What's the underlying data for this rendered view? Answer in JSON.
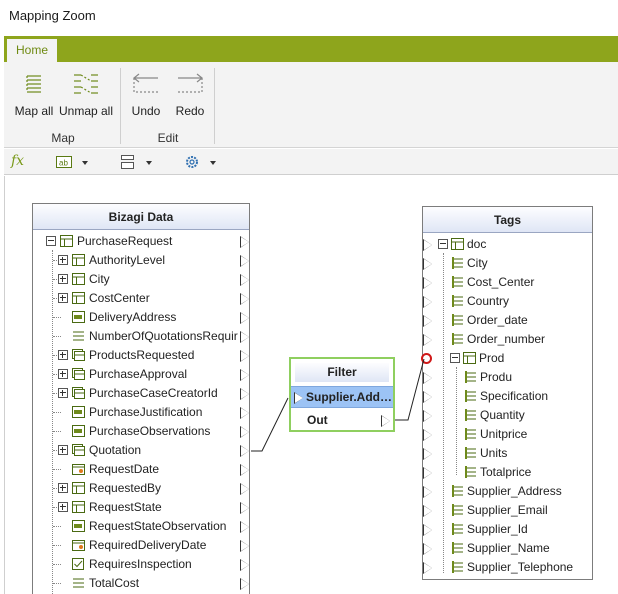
{
  "window": {
    "title": "Mapping Zoom"
  },
  "ribbon": {
    "tab_home": "Home",
    "map_all": "Map all",
    "unmap_all": "Unmap all",
    "undo": "Undo",
    "redo": "Redo",
    "group_map": "Map",
    "group_edit": "Edit"
  },
  "toolbar": {
    "fx": "fx",
    "text_icon_label": "ab"
  },
  "left_panel": {
    "title": "Bizagi Data",
    "items": [
      {
        "label": "PurchaseRequest",
        "icon": "entity-icon"
      },
      {
        "label": "AuthorityLevel",
        "icon": "table-icon"
      },
      {
        "label": "City",
        "icon": "table-icon"
      },
      {
        "label": "CostCenter",
        "icon": "table-icon"
      },
      {
        "label": "DeliveryAddress",
        "icon": "text-field-icon"
      },
      {
        "label": "NumberOfQuotationsRequir",
        "icon": "number-field-icon"
      },
      {
        "label": "ProductsRequested",
        "icon": "collection-icon"
      },
      {
        "label": "PurchaseApproval",
        "icon": "collection-icon"
      },
      {
        "label": "PurchaseCaseCreatorId",
        "icon": "collection-icon"
      },
      {
        "label": "PurchaseJustification",
        "icon": "text-field-icon"
      },
      {
        "label": "PurchaseObservations",
        "icon": "text-field-icon"
      },
      {
        "label": "Quotation",
        "icon": "collection-icon"
      },
      {
        "label": "RequestDate",
        "icon": "date-field-icon"
      },
      {
        "label": "RequestedBy",
        "icon": "entity-icon"
      },
      {
        "label": "RequestState",
        "icon": "table-icon"
      },
      {
        "label": "RequestStateObservation",
        "icon": "text-field-icon"
      },
      {
        "label": "RequiredDeliveryDate",
        "icon": "date-field-icon"
      },
      {
        "label": "RequiresInspection",
        "icon": "checkbox-field-icon"
      },
      {
        "label": "TotalCost",
        "icon": "number-field-icon"
      }
    ]
  },
  "filter_node": {
    "title": "Filter",
    "selected": "Supplier.Add…",
    "out": "Out"
  },
  "right_panel": {
    "title": "Tags",
    "items": [
      {
        "label": "doc"
      },
      {
        "label": "City"
      },
      {
        "label": "Cost_Center"
      },
      {
        "label": "Country"
      },
      {
        "label": "Order_date"
      },
      {
        "label": "Order_number"
      },
      {
        "label": "Prod"
      },
      {
        "label": "Produ"
      },
      {
        "label": "Specification"
      },
      {
        "label": "Quantity"
      },
      {
        "label": "Unitprice"
      },
      {
        "label": "Units"
      },
      {
        "label": "Totalprice"
      },
      {
        "label": "Supplier_Address"
      },
      {
        "label": "Supplier_Email"
      },
      {
        "label": "Supplier_Id"
      },
      {
        "label": "Supplier_Name"
      },
      {
        "label": "Supplier_Telephone"
      }
    ]
  },
  "colors": {
    "ribbon_green": "#8ea51c",
    "selection_blue": "#9cc3f5",
    "filter_border": "#8fcf5f"
  }
}
